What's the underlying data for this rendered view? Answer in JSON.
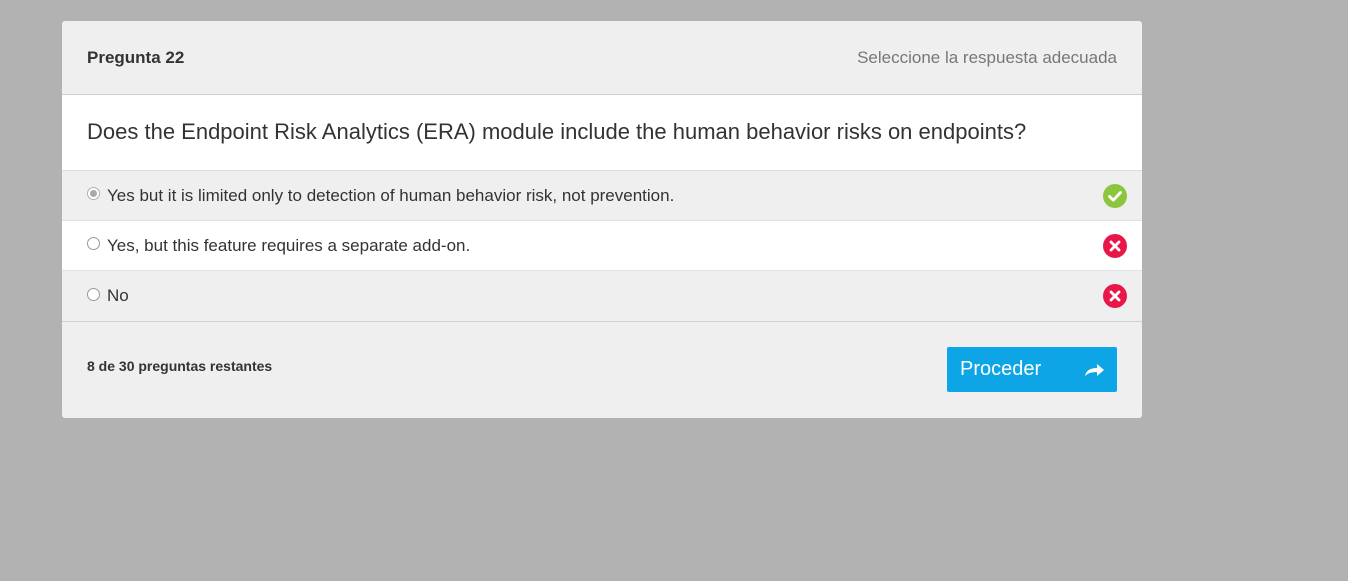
{
  "header": {
    "question_number": "Pregunta 22",
    "instruction": "Seleccione la respuesta adecuada"
  },
  "question": {
    "text": "Does the Endpoint Risk Analytics (ERA) module include the human behavior risks on endpoints?"
  },
  "options": [
    {
      "label": "Yes but it is limited only to detection of human behavior risk, not prevention.",
      "selected": true,
      "status": "correct",
      "icon": "check-circle-icon"
    },
    {
      "label": "Yes, but this feature requires a separate add-on.",
      "selected": false,
      "status": "incorrect",
      "icon": "x-circle-icon"
    },
    {
      "label": "No",
      "selected": false,
      "status": "incorrect",
      "icon": "x-circle-icon"
    }
  ],
  "footer": {
    "remaining": "8 de 30 preguntas restantes",
    "proceed_label": "Proceder",
    "proceed_icon": "share-arrow-icon"
  },
  "colors": {
    "background": "#b2b2b2",
    "accent": "#0ea5e6",
    "correct": "#8cc63f",
    "incorrect": "#e8174a"
  }
}
